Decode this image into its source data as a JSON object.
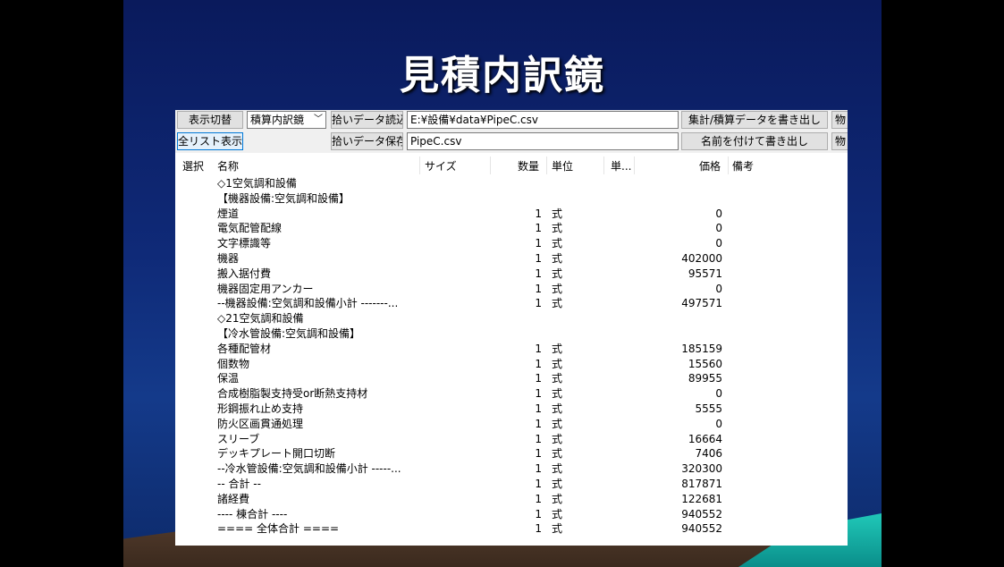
{
  "slide": {
    "title": "見積内訳鏡"
  },
  "toolbar": {
    "display_toggle": "表示切替",
    "view_combo": "積算内訳鏡",
    "load_pickup": "拾いデータ読込",
    "save_pickup": "拾いデータ保存",
    "file_path": "E:¥設備¥data¥PipeC.csv",
    "file_name": "PipeC.csv",
    "export_totals": "集計/積算データを書き出し",
    "export_named": "名前を付けて書き出し",
    "extra_1": "物",
    "extra_2": "物",
    "full_list": "全リスト表示"
  },
  "columns": [
    "選択",
    "名称",
    "サイズ",
    "数量",
    "単位",
    "単...",
    "価格",
    "備考"
  ],
  "rows": [
    {
      "name": "◇1空気調和設備",
      "qty": "",
      "unit": "",
      "price": ""
    },
    {
      "name": "【機器設備:空気調和設備】",
      "qty": "",
      "unit": "",
      "price": ""
    },
    {
      "name": "煙道",
      "qty": "1",
      "unit": "式",
      "price": "0"
    },
    {
      "name": "電気配管配線",
      "qty": "1",
      "unit": "式",
      "price": "0"
    },
    {
      "name": "文字標識等",
      "qty": "1",
      "unit": "式",
      "price": "0"
    },
    {
      "name": "機器",
      "qty": "1",
      "unit": "式",
      "price": "402000"
    },
    {
      "name": "搬入据付費",
      "qty": "1",
      "unit": "式",
      "price": "95571"
    },
    {
      "name": "機器固定用アンカー",
      "qty": "1",
      "unit": "式",
      "price": "0"
    },
    {
      "name": "--機器設備:空気調和設備小計 -------...",
      "qty": "1",
      "unit": "式",
      "price": "497571"
    },
    {
      "name": "◇21空気調和設備",
      "qty": "",
      "unit": "",
      "price": ""
    },
    {
      "name": "【冷水管設備:空気調和設備】",
      "qty": "",
      "unit": "",
      "price": ""
    },
    {
      "name": "各種配管材",
      "qty": "1",
      "unit": "式",
      "price": "185159"
    },
    {
      "name": "個数物",
      "qty": "1",
      "unit": "式",
      "price": "15560"
    },
    {
      "name": "保温",
      "qty": "1",
      "unit": "式",
      "price": "89955"
    },
    {
      "name": "合成樹脂製支持受or断熱支持材",
      "qty": "1",
      "unit": "式",
      "price": "0"
    },
    {
      "name": "形鋼振れ止め支持",
      "qty": "1",
      "unit": "式",
      "price": "5555"
    },
    {
      "name": "防火区画貫通処理",
      "qty": "1",
      "unit": "式",
      "price": "0"
    },
    {
      "name": "スリーブ",
      "qty": "1",
      "unit": "式",
      "price": "16664"
    },
    {
      "name": "デッキプレート開口切断",
      "qty": "1",
      "unit": "式",
      "price": "7406"
    },
    {
      "name": "--冷水管設備:空気調和設備小計 -----...",
      "qty": "1",
      "unit": "式",
      "price": "320300"
    },
    {
      "name": "-- 合計 --",
      "qty": "1",
      "unit": "式",
      "price": "817871"
    },
    {
      "name": "諸経費",
      "qty": "1",
      "unit": "式",
      "price": "122681"
    },
    {
      "name": "---- 棟合計 ----",
      "qty": "1",
      "unit": "式",
      "price": "940552"
    },
    {
      "name": "==== 全体合計 ====",
      "qty": "1",
      "unit": "式",
      "price": "940552"
    }
  ]
}
